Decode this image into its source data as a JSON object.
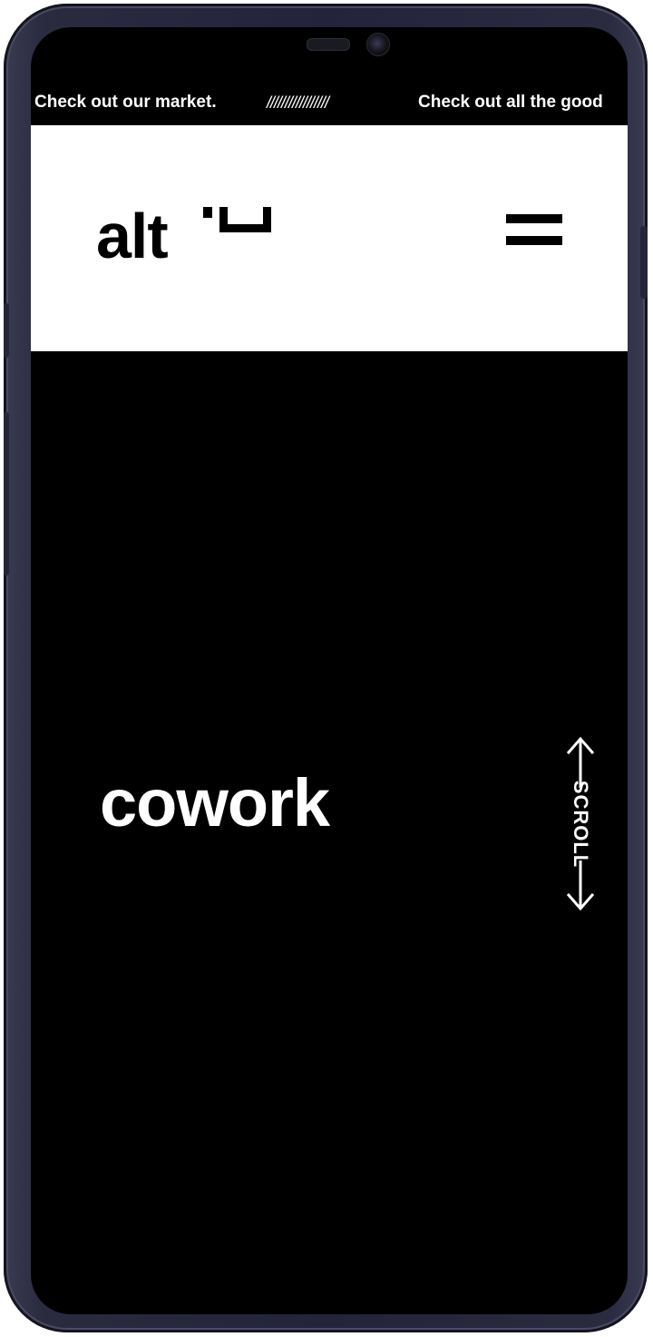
{
  "ticker": {
    "item_1": "Check out our market.",
    "separator": "/////////////////",
    "item_2": "Check out all the good"
  },
  "header": {
    "logo_text": "alt",
    "logo_icon": "bracket-mark-icon",
    "menu_icon": "hamburger-menu-icon"
  },
  "hero": {
    "word": "cowork",
    "scroll_label": "SCROLL",
    "scroll_icon": "double-arrow-vertical-icon"
  },
  "colors": {
    "background": "#000000",
    "header_bg": "#ffffff",
    "text_light": "#ffffff",
    "text_dark": "#000000"
  }
}
